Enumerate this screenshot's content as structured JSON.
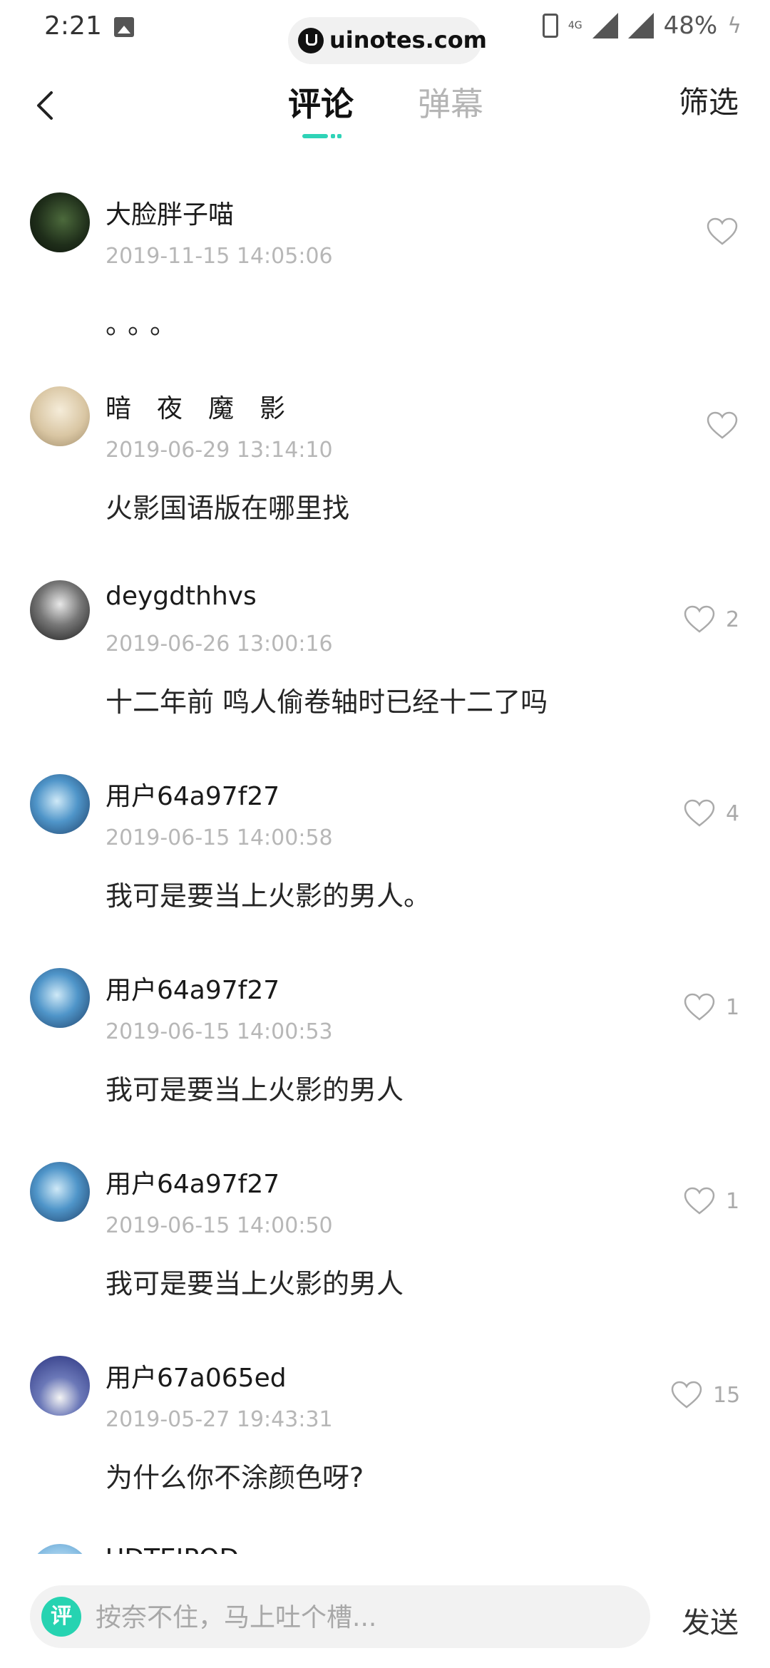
{
  "status_bar": {
    "time": "2:21",
    "network": "4G",
    "battery": "48%"
  },
  "watermark": "uinotes.com",
  "header": {
    "tabs": [
      {
        "label": "评论",
        "active": true
      },
      {
        "label": "弹幕",
        "active": false
      }
    ],
    "filter_label": "筛选"
  },
  "colors": {
    "accent": "#2ed3b7",
    "timestamp": "#b7b7b7",
    "inactive_tab": "#b5b5b5"
  },
  "comments": [
    {
      "user": "大脸胖子喵",
      "time": "2019-11-15 14:05:06",
      "text": "。。。",
      "likes": ""
    },
    {
      "user": "暗　夜　魔　影",
      "time": "2019-06-29 13:14:10",
      "text": "火影国语版在哪里找",
      "likes": ""
    },
    {
      "user": "deygdthhvs",
      "time": "2019-06-26 13:00:16",
      "text": "十二年前 鸣人偷卷轴时已经十二了吗",
      "likes": "2"
    },
    {
      "user": "用户64a97f27",
      "time": "2019-06-15 14:00:58",
      "text": "我可是要当上火影的男人。",
      "likes": "4"
    },
    {
      "user": "用户64a97f27",
      "time": "2019-06-15 14:00:53",
      "text": "我可是要当上火影的男人",
      "likes": "1"
    },
    {
      "user": "用户64a97f27",
      "time": "2019-06-15 14:00:50",
      "text": "我可是要当上火影的男人",
      "likes": "1"
    },
    {
      "user": "用户67a065ed",
      "time": "2019-05-27 19:43:31",
      "text": "为什么你不涂颜色呀?",
      "likes": "15"
    },
    {
      "user": "UDTEIPQD"
    }
  ],
  "input_bar": {
    "badge": "评",
    "placeholder": "按奈不住，马上吐个槽...",
    "send_label": "发送"
  }
}
